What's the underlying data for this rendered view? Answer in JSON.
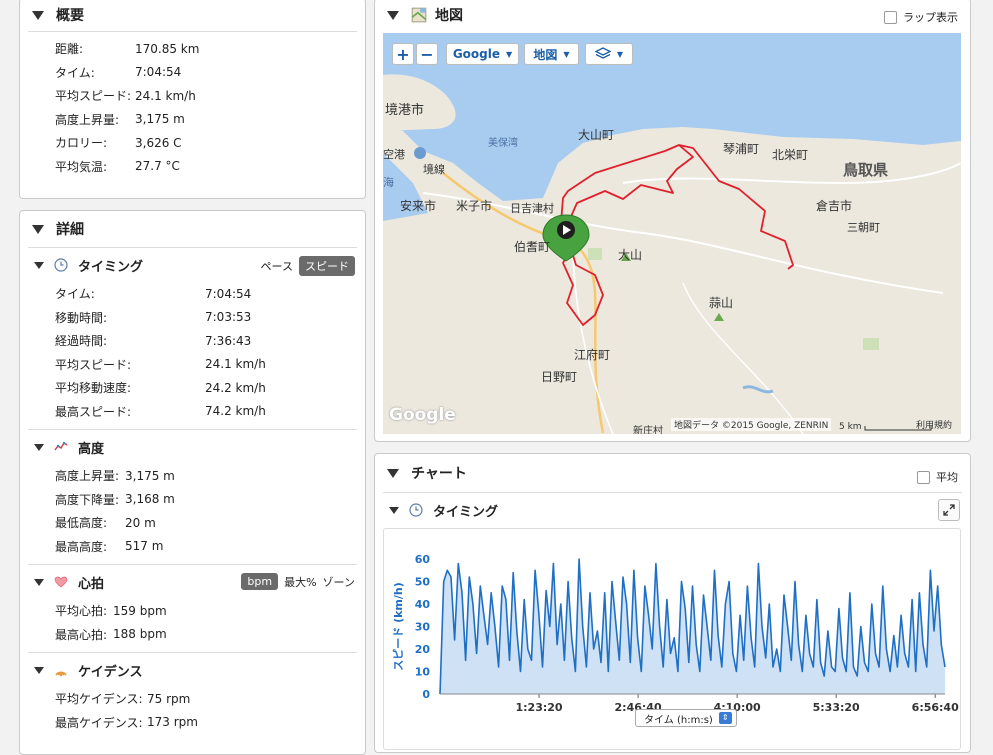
{
  "summary": {
    "title": "概要",
    "rows": [
      {
        "label": "距離:",
        "value": "170.85 km"
      },
      {
        "label": "タイム:",
        "value": "7:04:54"
      },
      {
        "label": "平均スピード:",
        "value": "24.1 km/h"
      },
      {
        "label": "高度上昇量:",
        "value": "3,175 m"
      },
      {
        "label": "カロリー:",
        "value": "3,626 C"
      },
      {
        "label": "平均気温:",
        "value": "27.7 °C"
      }
    ]
  },
  "details": {
    "title": "詳細",
    "timing": {
      "title": "タイミング",
      "pace_label": "ペース",
      "speed_label": "スピード",
      "rows": [
        {
          "label": "タイム:",
          "value": "7:04:54"
        },
        {
          "label": "移動時間:",
          "value": "7:03:53"
        },
        {
          "label": "経過時間:",
          "value": "7:36:43"
        },
        {
          "label": "平均スピード:",
          "value": "24.1 km/h"
        },
        {
          "label": "平均移動速度:",
          "value": "24.2 km/h"
        },
        {
          "label": "最高スピード:",
          "value": "74.2 km/h"
        }
      ]
    },
    "elevation": {
      "title": "高度",
      "rows": [
        {
          "label": "高度上昇量:",
          "value": "3,175 m"
        },
        {
          "label": "高度下降量:",
          "value": "3,168 m"
        },
        {
          "label": "最低高度:",
          "value": "20 m"
        },
        {
          "label": "最高高度:",
          "value": "517 m"
        }
      ]
    },
    "heart_rate": {
      "title": "心拍",
      "bpm_label": "bpm",
      "max_label": "最大%",
      "zone_label": "ゾーン",
      "rows": [
        {
          "label": "平均心拍:",
          "value": "159 bpm"
        },
        {
          "label": "最高心拍:",
          "value": "188 bpm"
        }
      ]
    },
    "cadence": {
      "title": "ケイデンス",
      "rows": [
        {
          "label": "平均ケイデンス:",
          "value": "75 rpm"
        },
        {
          "label": "最高ケイデンス:",
          "value": "173 rpm"
        }
      ]
    }
  },
  "map": {
    "title": "地図",
    "lap_label": "ラップ表示",
    "zoom_in": "+",
    "zoom_out": "−",
    "provider": "Google",
    "map_type": "地図",
    "attribution": "地図データ ©2015 Google, ZENRIN",
    "scale": "5 km",
    "terms": "利用規約",
    "logo": "Google",
    "places": {
      "sakaiminato": "境港市",
      "daisen_town": "大山町",
      "kotoura": "琴浦町",
      "hokuei": "北栄町",
      "tottori": "鳥取県",
      "miho": "美保湾",
      "airport": "空港",
      "sakai_line": "境線",
      "yasugi": "安来市",
      "yonago": "米子市",
      "hiezu": "日吉津村",
      "hoki": "伯耆町",
      "daisen": "大山",
      "kurayoshi": "倉吉市",
      "misasa": "三朝町",
      "hiruzen": "蒜山",
      "kofu": "江府町",
      "hino": "日野町",
      "shinjo": "新庄村",
      "sea": "海"
    }
  },
  "chart": {
    "title": "チャート",
    "avg_label": "平均",
    "timing_title": "タイミング",
    "x_selector": "タイム (h:m:s)"
  },
  "colors": {
    "line": "#1f6fc5",
    "fill": "#cfe2f5",
    "route": "#e0202c",
    "marker": "#48a23f"
  },
  "chart_data": {
    "type": "area",
    "ylabel": "スピード (km/h)",
    "ylim": [
      0,
      60
    ],
    "yticks": [
      0,
      10,
      20,
      30,
      40,
      50,
      60
    ],
    "xticks": [
      "1:23:20",
      "2:46:40",
      "4:10:00",
      "5:33:20",
      "6:56:40"
    ],
    "x_max_seconds": 25494,
    "series": [
      {
        "values": [
          0,
          50,
          55,
          52,
          24,
          58,
          45,
          15,
          52,
          40,
          18,
          48,
          35,
          22,
          45,
          30,
          12,
          48,
          42,
          15,
          54,
          28,
          10,
          42,
          20,
          15,
          55,
          36,
          12,
          46,
          30,
          58,
          22,
          40,
          15,
          50,
          25,
          10,
          60,
          30,
          12,
          45,
          20,
          28,
          14,
          45,
          10,
          50,
          32,
          15,
          52,
          40,
          14,
          55,
          25,
          10,
          48,
          35,
          20,
          58,
          30,
          12,
          42,
          18,
          25,
          10,
          50,
          38,
          14,
          48,
          22,
          10,
          44,
          30,
          15,
          55,
          26,
          12,
          40,
          50,
          18,
          10,
          35,
          15,
          48,
          25,
          12,
          58,
          30,
          16,
          40,
          12,
          20,
          10,
          44,
          30,
          15,
          50,
          22,
          10,
          35,
          18,
          12,
          42,
          14,
          8,
          28,
          12,
          10,
          38,
          16,
          10,
          45,
          12,
          8,
          30,
          14,
          10,
          40,
          18,
          12,
          48,
          20,
          10,
          26,
          12,
          35,
          18,
          12,
          42,
          10,
          45,
          22,
          12,
          55,
          28,
          48,
          22,
          12
        ]
      }
    ]
  }
}
